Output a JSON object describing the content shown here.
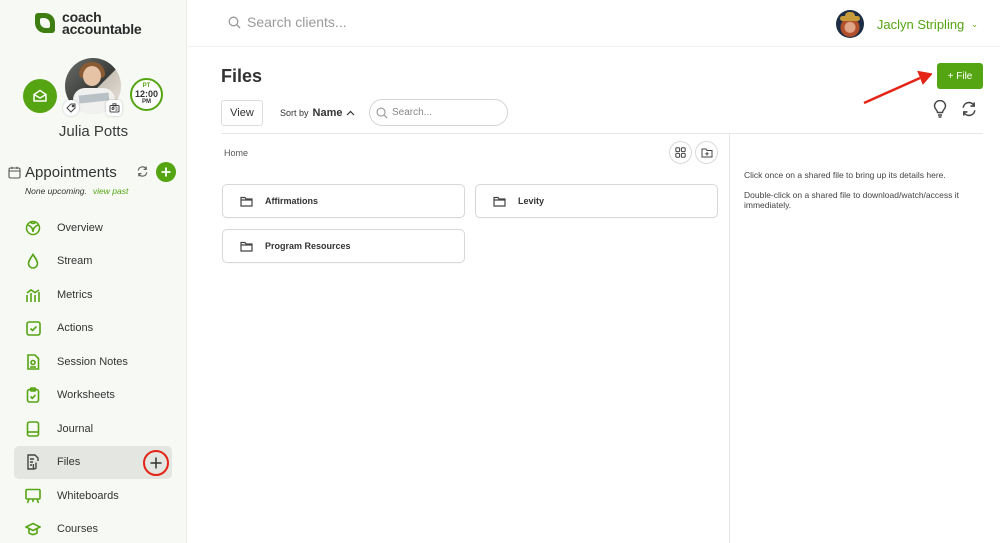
{
  "brand": {
    "line1": "coach",
    "line2": "accountable"
  },
  "client": {
    "name": "Julia Potts",
    "timezone": {
      "zone": "PT",
      "time": "12:00",
      "ampm": "PM"
    }
  },
  "appointments": {
    "title": "Appointments",
    "status": "None upcoming.",
    "view_past": "view past"
  },
  "nav": {
    "items": [
      {
        "label": "Overview",
        "icon": "overview-icon",
        "active": false
      },
      {
        "label": "Stream",
        "icon": "stream-icon",
        "active": false
      },
      {
        "label": "Metrics",
        "icon": "metrics-icon",
        "active": false
      },
      {
        "label": "Actions",
        "icon": "actions-icon",
        "active": false
      },
      {
        "label": "Session Notes",
        "icon": "session-notes-icon",
        "active": false
      },
      {
        "label": "Worksheets",
        "icon": "worksheets-icon",
        "active": false
      },
      {
        "label": "Journal",
        "icon": "journal-icon",
        "active": false
      },
      {
        "label": "Files",
        "icon": "files-icon",
        "active": true
      },
      {
        "label": "Whiteboards",
        "icon": "whiteboards-icon",
        "active": false
      },
      {
        "label": "Courses",
        "icon": "courses-icon",
        "active": false
      }
    ],
    "add_label": "+"
  },
  "topbar": {
    "search_placeholder": "Search clients...",
    "user_name": "Jaclyn Stripling",
    "caret": "⌄"
  },
  "page": {
    "title": "Files",
    "view_label": "View",
    "sort_prefix": "Sort by",
    "sort_field": "Name",
    "sort_dir": "^",
    "search_placeholder": "Search...",
    "add_file_label": "+ File"
  },
  "browser": {
    "breadcrumb": "Home",
    "folders": [
      {
        "name": "Affirmations"
      },
      {
        "name": "Levity"
      },
      {
        "name": "Program Resources"
      }
    ]
  },
  "details": {
    "hint1": "Click once on a shared file to bring up its details here.",
    "hint2": "Double-click on a shared file to download/watch/access it immediately."
  },
  "colors": {
    "brand_green": "#55a513",
    "annotation_red": "#e42417"
  }
}
